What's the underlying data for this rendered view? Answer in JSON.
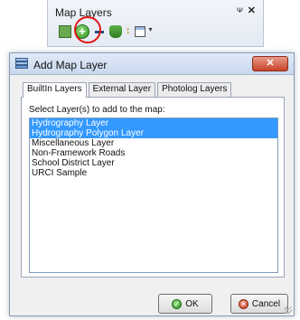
{
  "panel": {
    "title": "Map Layers",
    "pin_glyph": "ᴪ",
    "close_glyph": "✕",
    "toolbar": {
      "add_glyph": "+",
      "sort_glyph": "↕",
      "caret_glyph": "▾",
      "icons": [
        "grid-icon",
        "add-layer-icon",
        "remove-layer-icon",
        "layers-icon",
        "sort-icon",
        "properties-icon"
      ]
    }
  },
  "dialog": {
    "title": "Add Map Layer",
    "close_glyph": "✕",
    "tabs": [
      {
        "label": "BuiltIn Layers",
        "active": true
      },
      {
        "label": "External Layer",
        "active": false
      },
      {
        "label": "Photolog Layers",
        "active": false
      }
    ],
    "list_label": "Select Layer(s) to add to the map:",
    "layers": [
      {
        "label": "Hydrography Layer",
        "selected": true
      },
      {
        "label": "Hydrography Polygon Layer",
        "selected": true
      },
      {
        "label": "Miscellaneous Layer",
        "selected": false
      },
      {
        "label": "Non-Framework Roads",
        "selected": false
      },
      {
        "label": "School District Layer",
        "selected": false
      },
      {
        "label": "URCI Sample",
        "selected": false
      }
    ],
    "ok_label": "OK",
    "ok_glyph": "✓",
    "cancel_label": "Cancel",
    "cancel_glyph": "✕"
  },
  "colors": {
    "selection": "#3399ff",
    "highlight_circle": "#e01414",
    "add_icon": "#2f8f1f"
  }
}
